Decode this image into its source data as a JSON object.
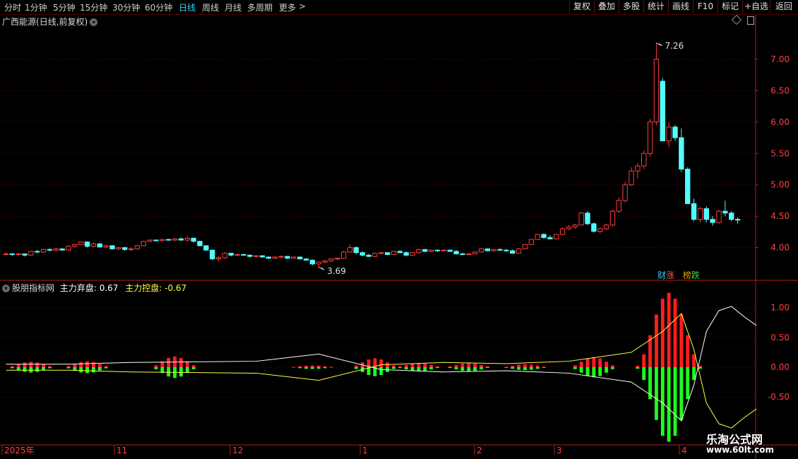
{
  "toolbar": {
    "timeframes": [
      "分时",
      "1分钟",
      "5分钟",
      "15分钟",
      "30分钟",
      "60分钟",
      "日线",
      "周线",
      "月线",
      "多周期",
      "更多"
    ],
    "active_timeframe": "日线",
    "more_arrow": ">",
    "right_buttons": [
      "复权",
      "叠加",
      "多股",
      "统计",
      "画线",
      "F10",
      "标记",
      "+自选",
      "返回"
    ]
  },
  "main_chart": {
    "stock_name": "广西能源",
    "period_desc": "(日线,前复权)",
    "menu_icon": "chevron-down-icon",
    "high_label": "7.26",
    "low_label": "3.69"
  },
  "badges": [
    {
      "text": "财",
      "color": "#38c8ff"
    },
    {
      "text": "涨",
      "color": "#ff5050"
    },
    {
      "text": "榜",
      "color": "#e0a000"
    },
    {
      "text": "跌",
      "color": "#30e030"
    }
  ],
  "indicator": {
    "name": "股朋指标网",
    "line1_label": "主力弃盘: 0.67",
    "line2_label": "主力控盘: -0.67",
    "line1_color": "#ffffff",
    "line2_color": "#ffff40"
  },
  "x_axis": {
    "labels": [
      "2025年",
      "11",
      "12",
      "1",
      "2",
      "3",
      "4"
    ]
  },
  "watermark": {
    "line1": "乐淘公式网",
    "line2": "www.60lt.com"
  },
  "colors": {
    "up": "#ff3c3c",
    "down": "#54fcfc",
    "grid": "#7a0000",
    "axis": "#b02020",
    "hist_pos": "#ff1e1e",
    "hist_neg": "#1eff1e"
  },
  "chart_data": [
    {
      "type": "candlestick",
      "title": "广西能源(日线,前复权)",
      "y_ticks": [
        4.0,
        4.5,
        5.0,
        5.5,
        6.0,
        6.5,
        7.0
      ],
      "ylim": [
        3.58,
        7.55
      ],
      "annotations": [
        {
          "text": "7.26",
          "value": 7.26
        },
        {
          "text": "3.69",
          "value": 3.69
        }
      ],
      "grid": true,
      "ohlc": [
        [
          3.9,
          3.92,
          3.88,
          3.9
        ],
        [
          3.9,
          3.91,
          3.87,
          3.89
        ],
        [
          3.89,
          3.91,
          3.87,
          3.9
        ],
        [
          3.9,
          3.91,
          3.86,
          3.88
        ],
        [
          3.88,
          3.95,
          3.87,
          3.94
        ],
        [
          3.94,
          3.96,
          3.91,
          3.93
        ],
        [
          3.93,
          3.98,
          3.92,
          3.97
        ],
        [
          3.97,
          3.99,
          3.94,
          3.96
        ],
        [
          3.96,
          4.0,
          3.94,
          3.98
        ],
        [
          3.98,
          3.99,
          3.95,
          3.96
        ],
        [
          3.96,
          4.04,
          3.95,
          4.02
        ],
        [
          4.02,
          4.06,
          4.0,
          4.05
        ],
        [
          4.05,
          4.1,
          4.04,
          4.09
        ],
        [
          4.09,
          4.1,
          4.0,
          4.02
        ],
        [
          4.02,
          4.08,
          4.0,
          4.06
        ],
        [
          4.06,
          4.07,
          4.0,
          4.01
        ],
        [
          4.01,
          4.05,
          3.99,
          4.03
        ],
        [
          4.03,
          4.04,
          3.97,
          3.98
        ],
        [
          3.98,
          4.01,
          3.96,
          4.0
        ],
        [
          4.0,
          4.01,
          3.95,
          3.97
        ],
        [
          3.97,
          4.0,
          3.95,
          3.98
        ],
        [
          3.98,
          4.04,
          3.97,
          4.03
        ],
        [
          4.03,
          4.11,
          4.02,
          4.1
        ],
        [
          4.1,
          4.13,
          4.09,
          4.12
        ],
        [
          4.12,
          4.13,
          4.1,
          4.11
        ],
        [
          4.11,
          4.14,
          4.1,
          4.13
        ],
        [
          4.13,
          4.14,
          4.11,
          4.12
        ],
        [
          4.12,
          4.15,
          4.1,
          4.14
        ],
        [
          4.14,
          4.16,
          4.11,
          4.12
        ],
        [
          4.12,
          4.18,
          4.1,
          4.15
        ],
        [
          4.15,
          4.16,
          4.08,
          4.1
        ],
        [
          4.1,
          4.11,
          4.02,
          4.03
        ],
        [
          4.03,
          4.04,
          3.95,
          3.96
        ],
        [
          3.96,
          3.97,
          3.8,
          3.82
        ],
        [
          3.82,
          3.86,
          3.78,
          3.84
        ],
        [
          3.84,
          3.93,
          3.82,
          3.91
        ],
        [
          3.91,
          3.92,
          3.86,
          3.88
        ],
        [
          3.88,
          3.9,
          3.86,
          3.89
        ],
        [
          3.89,
          3.9,
          3.87,
          3.88
        ],
        [
          3.88,
          3.89,
          3.84,
          3.86
        ],
        [
          3.86,
          3.88,
          3.84,
          3.87
        ],
        [
          3.87,
          3.88,
          3.84,
          3.85
        ],
        [
          3.85,
          3.86,
          3.82,
          3.83
        ],
        [
          3.83,
          3.86,
          3.82,
          3.85
        ],
        [
          3.85,
          3.87,
          3.83,
          3.86
        ],
        [
          3.86,
          3.87,
          3.82,
          3.83
        ],
        [
          3.83,
          3.86,
          3.82,
          3.85
        ],
        [
          3.85,
          3.86,
          3.81,
          3.82
        ],
        [
          3.82,
          3.83,
          3.79,
          3.8
        ],
        [
          3.8,
          3.81,
          3.72,
          3.74
        ],
        [
          3.74,
          3.78,
          3.69,
          3.77
        ],
        [
          3.77,
          3.8,
          3.75,
          3.79
        ],
        [
          3.79,
          3.83,
          3.77,
          3.82
        ],
        [
          3.82,
          3.84,
          3.8,
          3.83
        ],
        [
          3.83,
          3.95,
          3.82,
          3.93
        ],
        [
          3.93,
          4.05,
          3.92,
          4.0
        ],
        [
          4.0,
          4.02,
          3.9,
          3.92
        ],
        [
          3.92,
          3.94,
          3.86,
          3.88
        ],
        [
          3.88,
          3.9,
          3.85,
          3.86
        ],
        [
          3.86,
          3.92,
          3.85,
          3.91
        ],
        [
          3.91,
          3.93,
          3.89,
          3.92
        ],
        [
          3.92,
          3.93,
          3.88,
          3.89
        ],
        [
          3.89,
          3.95,
          3.88,
          3.94
        ],
        [
          3.94,
          3.96,
          3.91,
          3.92
        ],
        [
          3.92,
          3.94,
          3.86,
          3.88
        ],
        [
          3.88,
          3.93,
          3.87,
          3.92
        ],
        [
          3.92,
          3.98,
          3.91,
          3.97
        ],
        [
          3.97,
          3.98,
          3.93,
          3.94
        ],
        [
          3.94,
          3.97,
          3.93,
          3.96
        ],
        [
          3.96,
          3.97,
          3.93,
          3.95
        ],
        [
          3.95,
          3.97,
          3.94,
          3.96
        ],
        [
          3.96,
          3.97,
          3.93,
          3.94
        ],
        [
          3.94,
          3.96,
          3.89,
          3.9
        ],
        [
          3.9,
          3.92,
          3.88,
          3.89
        ],
        [
          3.89,
          3.91,
          3.88,
          3.9
        ],
        [
          3.9,
          3.94,
          3.89,
          3.93
        ],
        [
          3.93,
          3.99,
          3.92,
          3.98
        ],
        [
          3.98,
          3.99,
          3.94,
          3.95
        ],
        [
          3.95,
          3.98,
          3.94,
          3.97
        ],
        [
          3.97,
          3.99,
          3.95,
          3.96
        ],
        [
          3.96,
          3.98,
          3.93,
          3.95
        ],
        [
          3.95,
          3.97,
          3.9,
          3.91
        ],
        [
          3.91,
          3.99,
          3.9,
          3.98
        ],
        [
          3.98,
          4.06,
          3.97,
          4.05
        ],
        [
          4.05,
          4.14,
          4.04,
          4.13
        ],
        [
          4.13,
          4.22,
          4.12,
          4.21
        ],
        [
          4.21,
          4.23,
          4.14,
          4.16
        ],
        [
          4.16,
          4.2,
          4.13,
          4.14
        ],
        [
          4.14,
          4.22,
          4.13,
          4.21
        ],
        [
          4.21,
          4.32,
          4.2,
          4.3
        ],
        [
          4.3,
          4.36,
          4.28,
          4.33
        ],
        [
          4.33,
          4.38,
          4.3,
          4.36
        ],
        [
          4.36,
          4.57,
          4.35,
          4.55
        ],
        [
          4.55,
          4.58,
          4.36,
          4.38
        ],
        [
          4.38,
          4.4,
          4.24,
          4.26
        ],
        [
          4.26,
          4.32,
          4.22,
          4.3
        ],
        [
          4.3,
          4.38,
          4.28,
          4.36
        ],
        [
          4.36,
          4.6,
          4.34,
          4.58
        ],
        [
          4.58,
          4.8,
          4.55,
          4.75
        ],
        [
          4.75,
          5.05,
          4.72,
          5.0
        ],
        [
          5.0,
          5.28,
          4.98,
          5.22
        ],
        [
          5.22,
          5.35,
          5.1,
          5.3
        ],
        [
          5.3,
          5.55,
          5.25,
          5.5
        ],
        [
          5.5,
          6.05,
          5.45,
          6.0
        ],
        [
          6.0,
          7.26,
          5.95,
          7.0
        ],
        [
          6.65,
          6.7,
          5.7,
          5.7
        ],
        [
          5.7,
          6.0,
          5.6,
          5.92
        ],
        [
          5.92,
          5.95,
          5.7,
          5.75
        ],
        [
          5.75,
          5.9,
          5.2,
          5.25
        ],
        [
          5.25,
          5.28,
          4.7,
          4.7
        ],
        [
          4.7,
          4.78,
          4.42,
          4.45
        ],
        [
          4.45,
          4.65,
          4.4,
          4.62
        ],
        [
          4.62,
          4.66,
          4.4,
          4.45
        ],
        [
          4.45,
          4.5,
          4.35,
          4.4
        ],
        [
          4.4,
          4.6,
          4.38,
          4.58
        ],
        [
          4.58,
          4.75,
          4.5,
          4.55
        ],
        [
          4.55,
          4.58,
          4.42,
          4.45
        ],
        [
          4.45,
          4.48,
          4.38,
          4.44
        ]
      ]
    },
    {
      "type": "line+histogram",
      "title": "股朋指标网",
      "y_ticks": [
        -0.5,
        0.0,
        0.5,
        1.0
      ],
      "ylim": [
        -1.28,
        1.28
      ],
      "series": [
        {
          "name": "主力弃盘",
          "value": 0.67
        },
        {
          "name": "主力控盘",
          "value": -0.67
        }
      ],
      "pulse_peaks": [
        [
          4,
          0.09
        ],
        [
          13,
          0.1
        ],
        [
          27,
          0.18
        ],
        [
          49,
          0.03
        ],
        [
          59,
          0.15
        ],
        [
          66,
          0.07
        ],
        [
          74,
          0.07
        ],
        [
          83,
          0.05
        ],
        [
          94,
          0.17
        ],
        [
          106,
          1.25
        ]
      ],
      "line_points": [
        [
          0,
          0.05
        ],
        [
          10,
          0.05
        ],
        [
          20,
          0.08
        ],
        [
          40,
          0.1
        ],
        [
          50,
          0.22
        ],
        [
          60,
          -0.04
        ],
        [
          70,
          -0.08
        ],
        [
          80,
          -0.06
        ],
        [
          90,
          -0.1
        ],
        [
          100,
          -0.25
        ],
        [
          105,
          -0.6
        ],
        [
          108,
          -0.9
        ],
        [
          110,
          -0.3
        ],
        [
          112,
          0.6
        ],
        [
          114,
          0.95
        ],
        [
          116,
          1.02
        ],
        [
          118,
          0.85
        ],
        [
          120,
          0.7
        ]
      ]
    }
  ]
}
